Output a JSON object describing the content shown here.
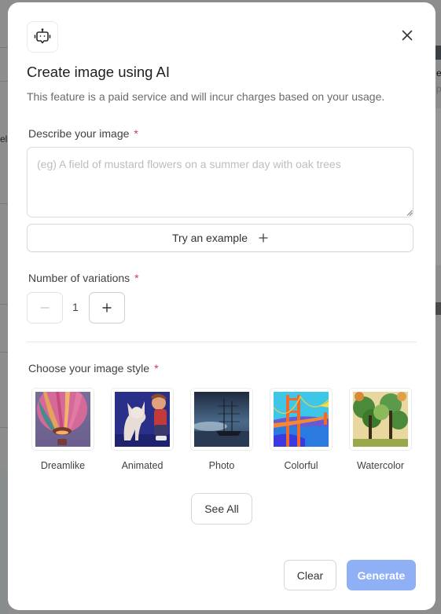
{
  "modal": {
    "title": "Create image using AI",
    "subtitle": "This feature is a paid service and will incur charges based on your usage.",
    "header_icon": "robot-icon",
    "close_icon": "close-icon"
  },
  "describe": {
    "label": "Describe your image",
    "required_mark": "*",
    "value": "",
    "placeholder": "(eg) A field of mustard flowers on a summer day with oak trees",
    "try_example_label": "Try an example",
    "try_example_icon": "plus-icon"
  },
  "variations": {
    "label": "Number of variations",
    "required_mark": "*",
    "value": "1",
    "decrement_icon": "minus-icon",
    "increment_icon": "plus-icon"
  },
  "style": {
    "label": "Choose your image style",
    "required_mark": "*",
    "options": [
      {
        "label": "Dreamlike",
        "thumbnail": "hot-air-balloon"
      },
      {
        "label": "Animated",
        "thumbnail": "cartoon-cat-and-boy"
      },
      {
        "label": "Photo",
        "thumbnail": "ship-at-sea"
      },
      {
        "label": "Colorful",
        "thumbnail": "golden-gate-bridge"
      },
      {
        "label": "Watercolor",
        "thumbnail": "trees-painting"
      }
    ],
    "see_all_label": "See All"
  },
  "footer": {
    "clear_label": "Clear",
    "generate_label": "Generate"
  },
  "colors": {
    "required": "#d8325a",
    "generate_disabled": "#8fb0f4",
    "overlay": "#8d8d8d"
  }
}
